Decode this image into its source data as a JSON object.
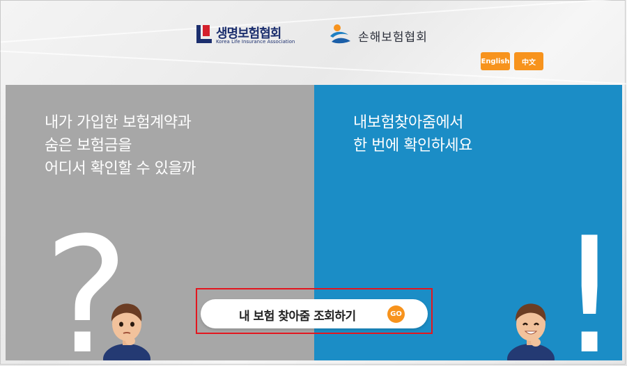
{
  "header": {
    "life_association": {
      "name": "생명보험협회",
      "subtitle": "Korea Life Insurance Association"
    },
    "nonlife_association": {
      "name": "손해보험협회"
    },
    "language_buttons": [
      {
        "label": "English"
      },
      {
        "label": "中文"
      }
    ]
  },
  "left_panel": {
    "lines": [
      "내가 가입한 보험계약과",
      "숨은 보험금을",
      "어디서 확인할 수 있을까"
    ],
    "symbol": "?"
  },
  "right_panel": {
    "lines": [
      "내보험찾아줌에서",
      "한 번에 확인하세요"
    ],
    "symbol": "!"
  },
  "cta": {
    "label": "내 보험 찾아줌 조회하기",
    "badge": "GO"
  },
  "colors": {
    "left_bg": "#a7a7a7",
    "right_bg": "#1b8dc6",
    "accent": "#f7931d",
    "highlight": "#e3161e",
    "brand_navy": "#1c2f6e",
    "brand_red": "#d4202c"
  }
}
